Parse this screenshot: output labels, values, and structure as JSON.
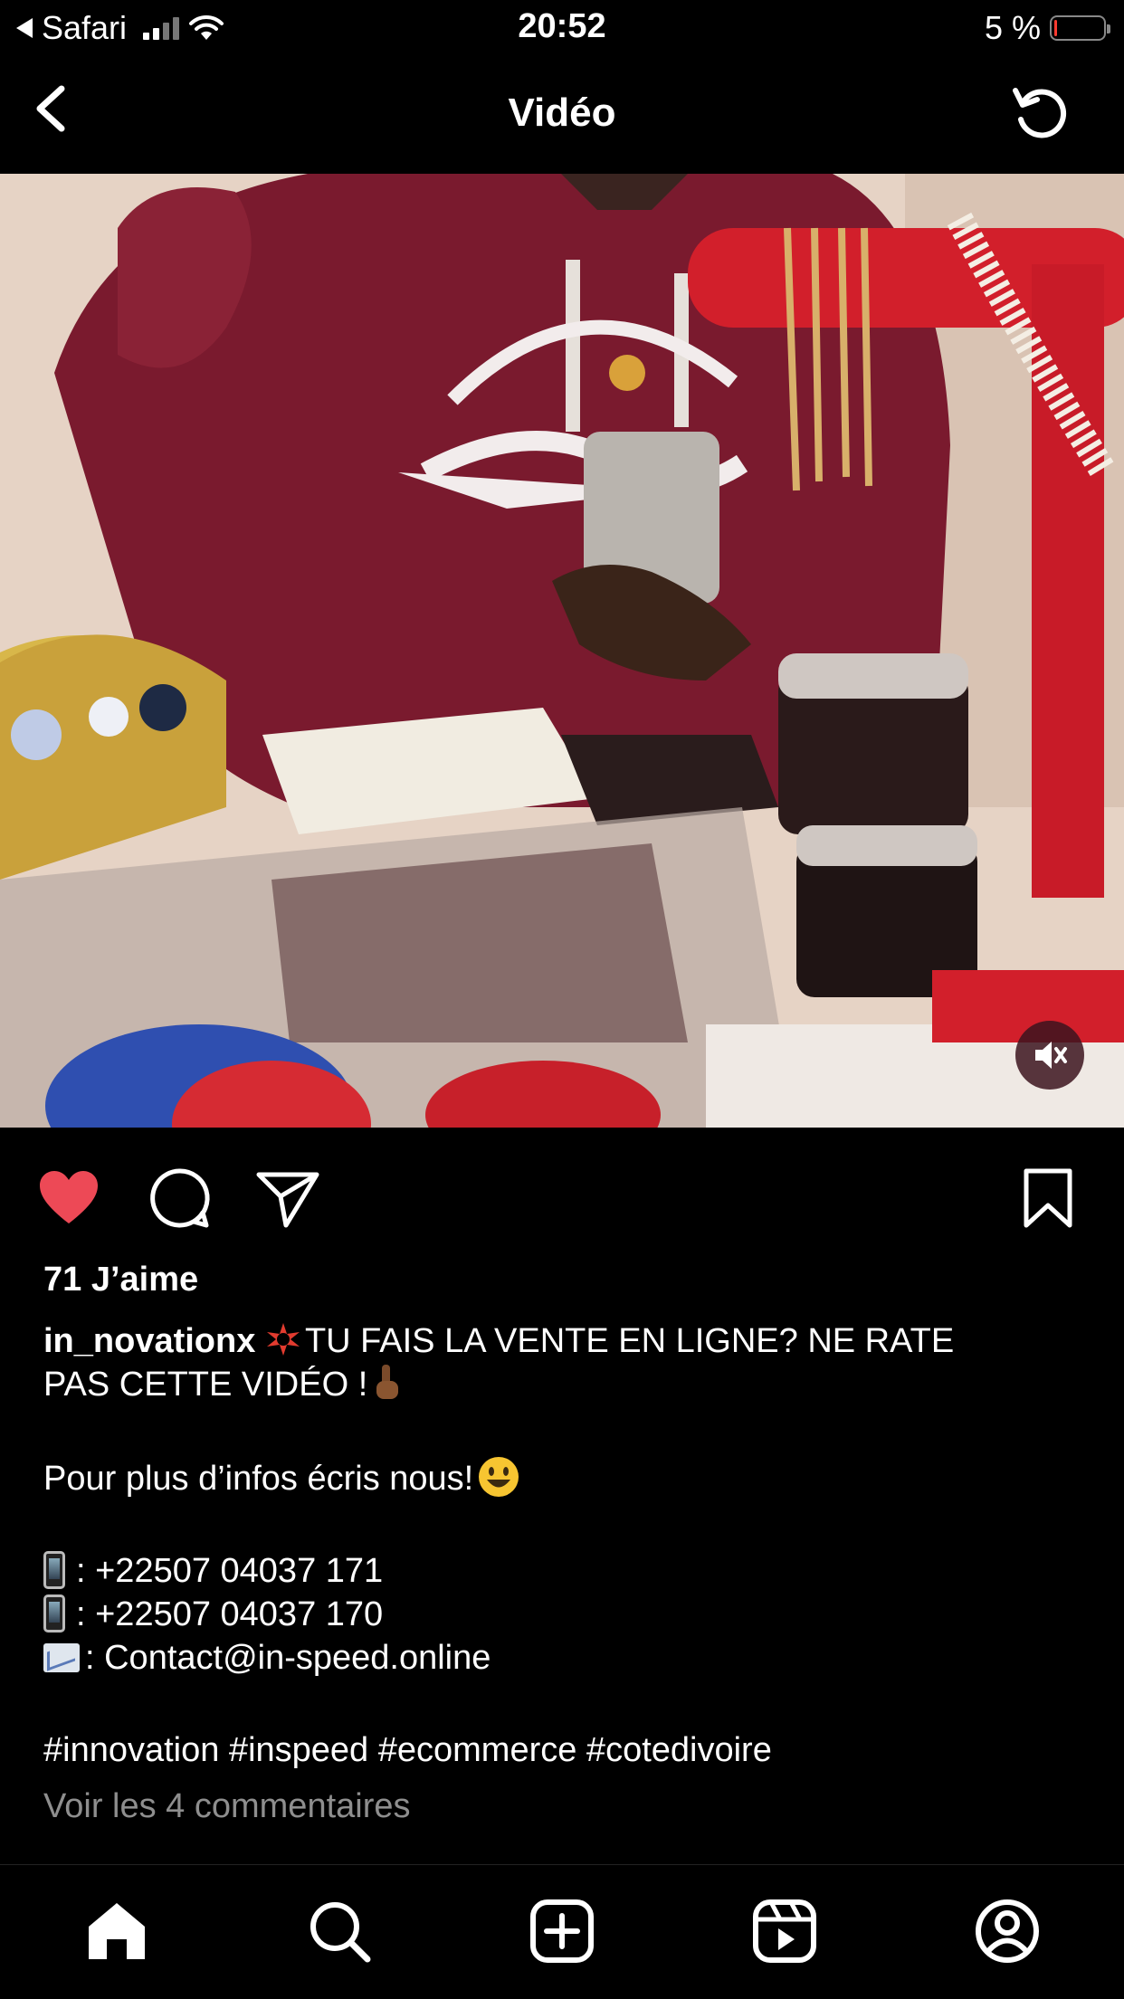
{
  "status_bar": {
    "carrier": "Safari",
    "time": "20:52",
    "battery_percent": "5 %",
    "battery_level": 0.05,
    "battery_color": "#ff3b30"
  },
  "header": {
    "title": "Vidéo",
    "back_icon": "chevron-left-icon",
    "refresh_icon": "refresh-icon"
  },
  "video": {
    "mute_icon": "speaker-muted-icon"
  },
  "actions": {
    "like_icon": "heart-filled-icon",
    "like_color": "#ed4956",
    "comment_icon": "comment-icon",
    "share_icon": "paper-plane-icon",
    "save_icon": "bookmark-icon"
  },
  "post": {
    "likes": "71 J’aime",
    "username": "in_novationx",
    "headline_1": "TU FAIS LA VENTE EN LIGNE? NE RATE",
    "headline_2": "PAS CETTE VIDÉO !",
    "info_line": "Pour plus d’infos écris nous!",
    "phone_1": ": +22507 04037 171",
    "phone_2": ": +22507 04037 170",
    "email": ": Contact@in-speed.online",
    "hashtags": "#innovation #inspeed #ecommerce #cotedivoire",
    "comments_link": "Voir les 4 commentaires"
  },
  "tab_bar": {
    "items": [
      "home-icon",
      "search-icon",
      "create-icon",
      "reels-icon",
      "profile-icon"
    ]
  }
}
